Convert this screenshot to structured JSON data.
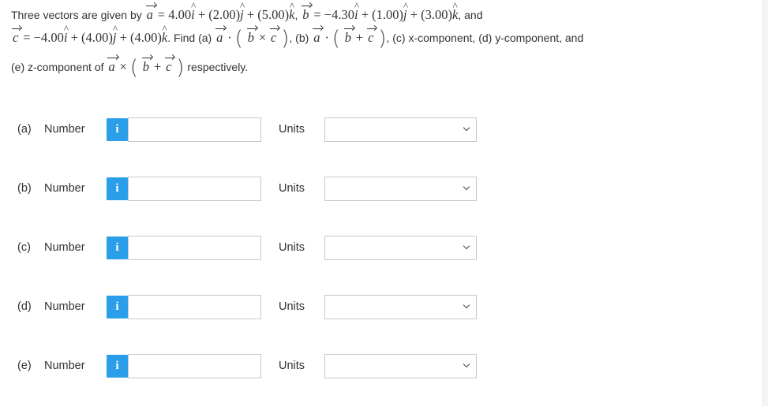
{
  "question": {
    "intro": "Three vectors are given by",
    "a_expr": "= 4.00",
    "a_j": " + (2.00)",
    "a_k": " + (5.00)",
    "comma1": ",",
    "b_expr": "= −4.30",
    "b_j": " + (1.00)",
    "b_k": " + (3.00)",
    "and1": ", and",
    "c_expr": "= −4.00",
    "c_j": " + (4.00)",
    "c_k": " + (4.00)",
    "find_a": ". Find (a)",
    "part_b": ", (b)",
    "part_cd": ", (c) x-component, (d) y-component, and",
    "part_e": "(e) z-component of",
    "respectively": "respectively."
  },
  "rows": [
    {
      "letter": "(a)",
      "label": "Number",
      "info": "i",
      "value": "",
      "units_label": "Units",
      "units_value": ""
    },
    {
      "letter": "(b)",
      "label": "Number",
      "info": "i",
      "value": "",
      "units_label": "Units",
      "units_value": ""
    },
    {
      "letter": "(c)",
      "label": "Number",
      "info": "i",
      "value": "",
      "units_label": "Units",
      "units_value": ""
    },
    {
      "letter": "(d)",
      "label": "Number",
      "info": "i",
      "value": "",
      "units_label": "Units",
      "units_value": ""
    },
    {
      "letter": "(e)",
      "label": "Number",
      "info": "i",
      "value": "",
      "units_label": "Units",
      "units_value": ""
    }
  ],
  "icons": {
    "info": "info-icon",
    "dropdown": "chevron-down-icon"
  },
  "colors": {
    "info_button": "#2a9ee8",
    "field_border": "#c8c8c8",
    "text": "#333333"
  }
}
